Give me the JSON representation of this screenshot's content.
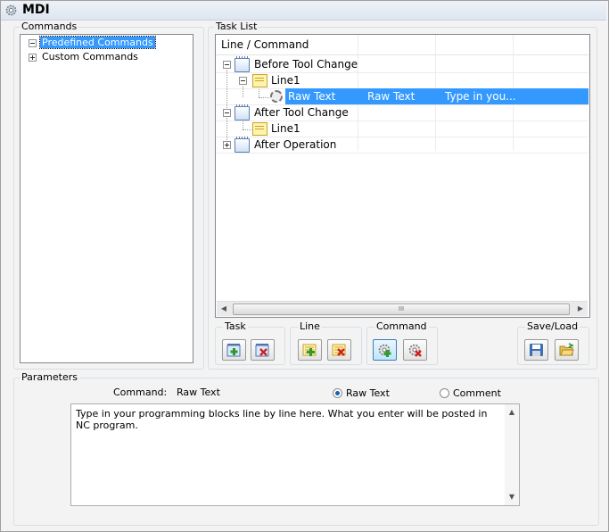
{
  "window": {
    "title": "MDI"
  },
  "commands": {
    "group_label": "Commands",
    "items": [
      {
        "label": "Predefined Commands",
        "selected": true
      },
      {
        "label": "Custom Commands",
        "selected": false
      }
    ]
  },
  "task_list": {
    "group_label": "Task List",
    "header": "Line / Command",
    "rows": [
      {
        "label": "Before Tool Change",
        "type": "task",
        "expanded": true
      },
      {
        "label": "Line1",
        "type": "line",
        "expanded": true
      },
      {
        "label": "Raw Text",
        "type": "command",
        "col2": "Raw Text",
        "col3": "Type in you...",
        "selected": true
      },
      {
        "label": "After Tool Change",
        "type": "task",
        "expanded": true
      },
      {
        "label": "Line1",
        "type": "line",
        "expanded": false
      },
      {
        "label": "After Operation",
        "type": "task",
        "expanded": false
      }
    ],
    "scroll_thumb": "III"
  },
  "toolbar": {
    "task_label": "Task",
    "line_label": "Line",
    "command_label": "Command",
    "saveload_label": "Save/Load"
  },
  "parameters": {
    "group_label": "Parameters",
    "command_label": "Command:",
    "command_value": "Raw Text",
    "radio_raw_text": "Raw Text",
    "radio_comment": "Comment",
    "selected_radio": "raw_text",
    "text": "Type in your programming blocks line by line here.  What you enter will be posted in NC program."
  },
  "colors": {
    "selection": "#3399ff",
    "border": "#828790"
  }
}
